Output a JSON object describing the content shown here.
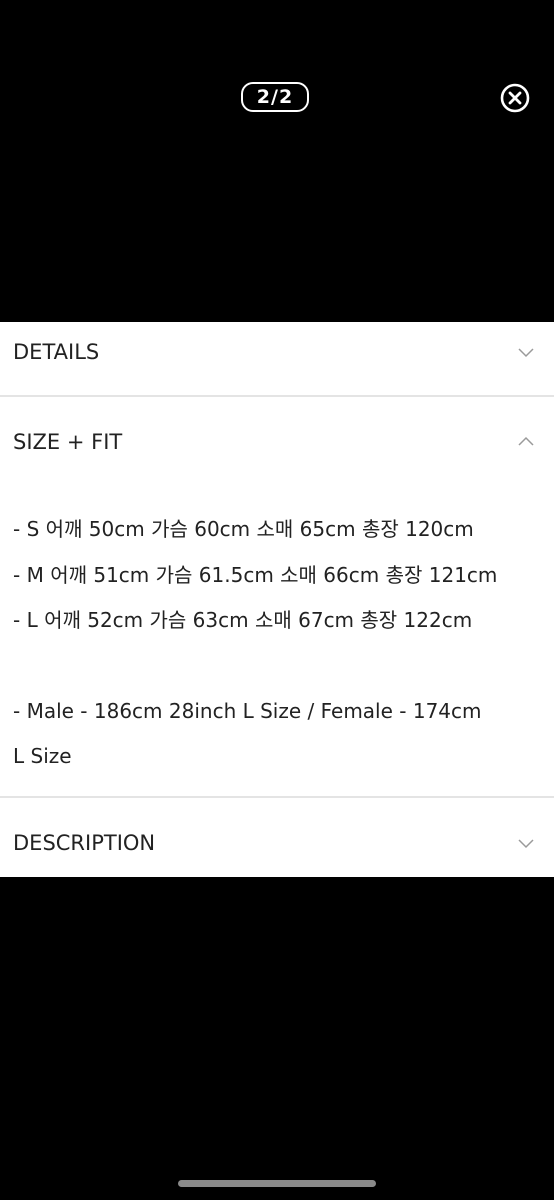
{
  "viewer": {
    "counter": "2/2",
    "close_icon": "close-circle-icon"
  },
  "sections": {
    "details": {
      "title": "DETAILS",
      "state": "collapsed",
      "icon": "chevron-down-icon"
    },
    "size_fit": {
      "title": "SIZE + FIT",
      "state": "expanded",
      "icon": "chevron-up-icon",
      "lines": [
        "- S 어깨 50cm 가슴 60cm 소매 65cm 총장 120cm",
        "- M 어깨 51cm 가슴 61.5cm 소매 66cm 총장 121cm",
        "- L 어깨 52cm 가슴 63cm 소매 67cm 총장 122cm",
        "- Male - 186cm 28inch L Size / Female - 174cm",
        "L Size"
      ]
    },
    "description": {
      "title": "DESCRIPTION",
      "state": "collapsed",
      "icon": "chevron-down-icon"
    }
  },
  "colors": {
    "background": "#000000",
    "sheet": "#ffffff",
    "text": "#222222",
    "divider": "#e4e4e4",
    "chevron": "#9a9a9a"
  }
}
